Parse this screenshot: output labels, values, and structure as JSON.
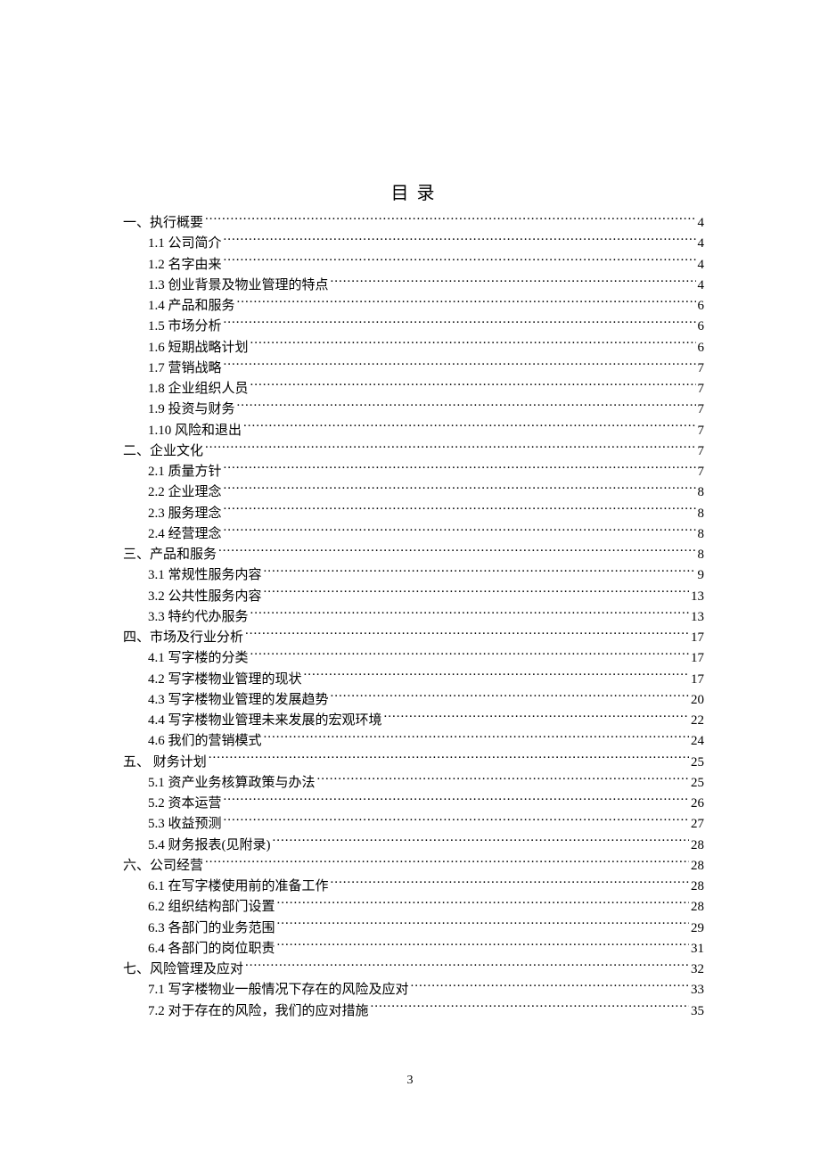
{
  "title": "目 录",
  "page_number": "3",
  "toc": [
    {
      "level": 1,
      "text": "一、执行概要",
      "page": "4"
    },
    {
      "level": 2,
      "text": "1.1 公司简介",
      "page": "4"
    },
    {
      "level": 2,
      "text": "1.2 名字由来",
      "page": "4"
    },
    {
      "level": 2,
      "text": "1.3 创业背景及物业管理的特点",
      "page": "4"
    },
    {
      "level": 2,
      "text": "1.4 产品和服务",
      "page": "6"
    },
    {
      "level": 2,
      "text": "1.5 市场分析",
      "page": "6"
    },
    {
      "level": 2,
      "text": "1.6 短期战略计划",
      "page": "6"
    },
    {
      "level": 2,
      "text": "1.7 营销战略",
      "page": "7"
    },
    {
      "level": 2,
      "text": "1.8 企业组织人员",
      "page": "7"
    },
    {
      "level": 2,
      "text": "1.9 投资与财务",
      "page": "7"
    },
    {
      "level": 2,
      "text": "1.10 风险和退出",
      "page": "7"
    },
    {
      "level": 1,
      "text": "二、企业文化",
      "page": "7"
    },
    {
      "level": 2,
      "text": "2.1 质量方针",
      "page": "7"
    },
    {
      "level": 2,
      "text": "2.2 企业理念",
      "page": "8"
    },
    {
      "level": 2,
      "text": "2.3 服务理念",
      "page": "8"
    },
    {
      "level": 2,
      "text": "2.4 经营理念",
      "page": "8"
    },
    {
      "level": 1,
      "text": "三、产品和服务",
      "page": "8"
    },
    {
      "level": 2,
      "text": "3.1 常规性服务内容",
      "page": "9"
    },
    {
      "level": 2,
      "text": "3.2 公共性服务内容",
      "page": "13"
    },
    {
      "level": 2,
      "text": "3.3 特约代办服务",
      "page": "13"
    },
    {
      "level": 1,
      "text": "四、市场及行业分析",
      "page": "17"
    },
    {
      "level": 2,
      "text": "4.1 写字楼的分类",
      "page": "17"
    },
    {
      "level": 2,
      "text": "4.2 写字楼物业管理的现状",
      "page": "17"
    },
    {
      "level": 2,
      "text": "4.3 写字楼物业管理的发展趋势",
      "page": "20"
    },
    {
      "level": 2,
      "text": "4.4 写字楼物业管理未来发展的宏观环境",
      "page": "22"
    },
    {
      "level": 2,
      "text": "4.6 我们的营销模式",
      "page": "24"
    },
    {
      "level": 1,
      "text": "五、 财务计划",
      "page": "25"
    },
    {
      "level": 2,
      "text": "5.1 资产业务核算政策与办法",
      "page": "25"
    },
    {
      "level": 2,
      "text": "5.2 资本运营",
      "page": "26"
    },
    {
      "level": 2,
      "text": "5.3 收益预测",
      "page": "27"
    },
    {
      "level": 2,
      "text": "5.4 财务报表(见附录)",
      "page": "28"
    },
    {
      "level": 1,
      "text": "六、公司经营",
      "page": "28"
    },
    {
      "level": 2,
      "text": "6.1 在写字楼使用前的准备工作",
      "page": "28"
    },
    {
      "level": 2,
      "text": "6.2 组织结构部门设置",
      "page": "28"
    },
    {
      "level": 2,
      "text": "6.3 各部门的业务范围",
      "page": "29"
    },
    {
      "level": 2,
      "text": "6.4 各部门的岗位职责",
      "page": "31"
    },
    {
      "level": 1,
      "text": "七、风险管理及应对",
      "page": "32"
    },
    {
      "level": 2,
      "text": "7.1 写字楼物业一般情况下存在的风险及应对",
      "page": "33"
    },
    {
      "level": 2,
      "text": "7.2 对于存在的风险，我们的应对措施",
      "page": "35"
    }
  ]
}
